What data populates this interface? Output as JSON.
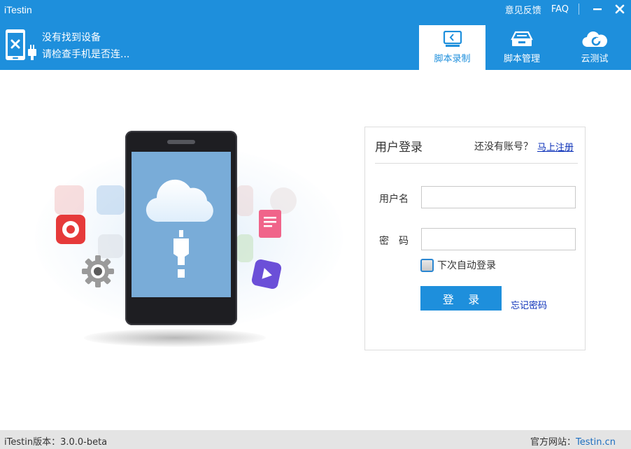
{
  "app": {
    "title": "iTestin"
  },
  "top_links": {
    "feedback": "意见反馈",
    "faq": "FAQ"
  },
  "device": {
    "status_line1": "没有找到设备",
    "status_line2": "请检查手机是否连..."
  },
  "tabs": [
    {
      "label": "脚本录制",
      "icon": "script-record-icon",
      "active": true
    },
    {
      "label": "脚本管理",
      "icon": "script-manage-icon",
      "active": false
    },
    {
      "label": "云测试",
      "icon": "cloud-test-icon",
      "active": false
    }
  ],
  "login": {
    "title": "用户登录",
    "no_account": "还没有账号？",
    "register": "马上注册",
    "username_label": "用户名",
    "username_value": "",
    "password_label": "密　码",
    "password_value": "",
    "auto_login": "下次自动登录",
    "auto_login_checked": false,
    "login_button": "登 录",
    "forgot_password": "忘记密码"
  },
  "footer": {
    "version": "iTestin版本：3.0.0-beta",
    "site_label": "官方网站：",
    "site_link": "Testin.cn"
  },
  "colors": {
    "brand_blue": "#1e8fdc",
    "link_blue": "#0a2fb8",
    "footer_bg": "#e4e4e4"
  }
}
